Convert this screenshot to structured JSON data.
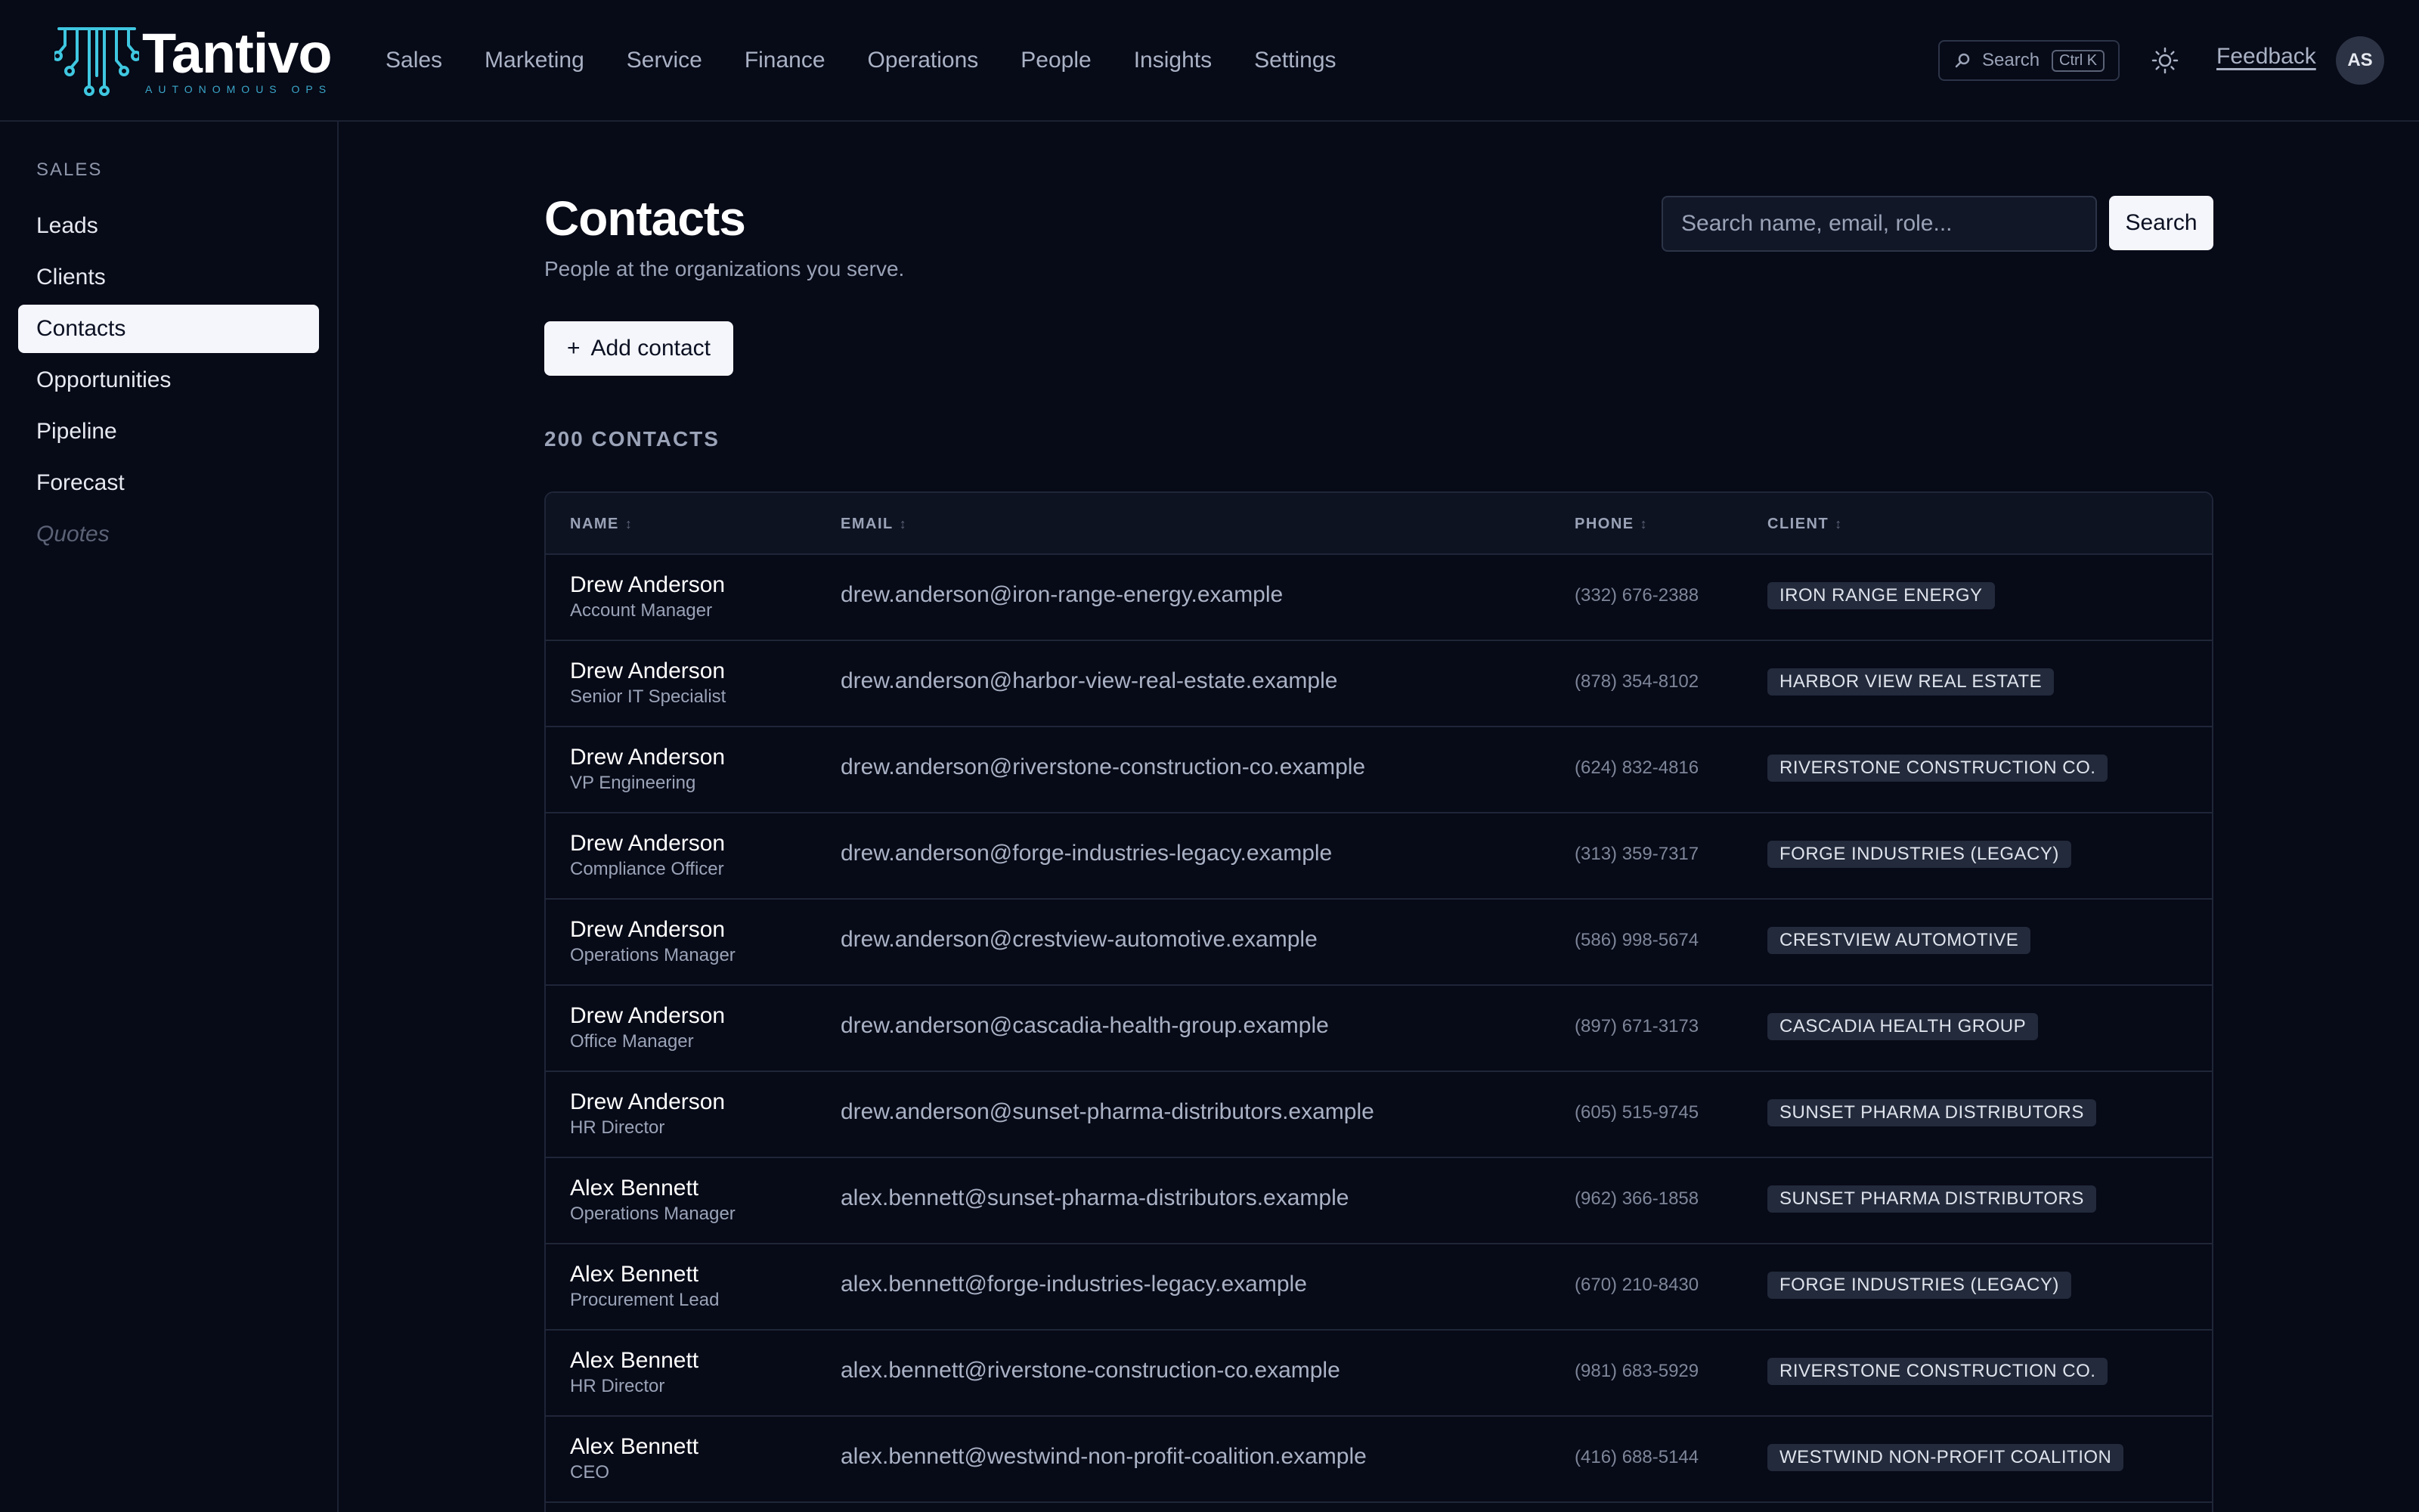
{
  "brand": {
    "name": "Tantivo",
    "tagline": "AUTONOMOUS OPS"
  },
  "nav": {
    "items": [
      {
        "label": "Sales",
        "active": true
      },
      {
        "label": "Marketing",
        "active": false
      },
      {
        "label": "Service",
        "active": false
      },
      {
        "label": "Finance",
        "active": false
      },
      {
        "label": "Operations",
        "active": false
      },
      {
        "label": "People",
        "active": false
      },
      {
        "label": "Insights",
        "active": false
      },
      {
        "label": "Settings",
        "active": false
      }
    ]
  },
  "topbar": {
    "search_label": "Search",
    "search_shortcut": "Ctrl K",
    "feedback_label": "Feedback",
    "avatar_initials": "AS"
  },
  "sidebar": {
    "heading": "SALES",
    "items": [
      {
        "label": "Leads",
        "state": "normal"
      },
      {
        "label": "Clients",
        "state": "normal"
      },
      {
        "label": "Contacts",
        "state": "active"
      },
      {
        "label": "Opportunities",
        "state": "normal"
      },
      {
        "label": "Pipeline",
        "state": "normal"
      },
      {
        "label": "Forecast",
        "state": "normal"
      },
      {
        "label": "Quotes",
        "state": "disabled"
      }
    ]
  },
  "page": {
    "title": "Contacts",
    "subtitle": "People at the organizations you serve.",
    "add_button_label": "Add contact",
    "add_button_icon": "+",
    "search_placeholder": "Search name, email, role...",
    "search_button_label": "Search",
    "count_label": "200 CONTACTS"
  },
  "table": {
    "columns": [
      "NAME",
      "EMAIL",
      "PHONE",
      "CLIENT"
    ],
    "sort_glyph": "↕",
    "rows": [
      {
        "name": "Drew Anderson",
        "role": "Account Manager",
        "email": "drew.anderson@iron-range-energy.example",
        "phone": "(332) 676-2388",
        "client": "IRON RANGE ENERGY"
      },
      {
        "name": "Drew Anderson",
        "role": "Senior IT Specialist",
        "email": "drew.anderson@harbor-view-real-estate.example",
        "phone": "(878) 354-8102",
        "client": "HARBOR VIEW REAL ESTATE"
      },
      {
        "name": "Drew Anderson",
        "role": "VP Engineering",
        "email": "drew.anderson@riverstone-construction-co.example",
        "phone": "(624) 832-4816",
        "client": "RIVERSTONE CONSTRUCTION CO."
      },
      {
        "name": "Drew Anderson",
        "role": "Compliance Officer",
        "email": "drew.anderson@forge-industries-legacy.example",
        "phone": "(313) 359-7317",
        "client": "FORGE INDUSTRIES (LEGACY)"
      },
      {
        "name": "Drew Anderson",
        "role": "Operations Manager",
        "email": "drew.anderson@crestview-automotive.example",
        "phone": "(586) 998-5674",
        "client": "CRESTVIEW AUTOMOTIVE"
      },
      {
        "name": "Drew Anderson",
        "role": "Office Manager",
        "email": "drew.anderson@cascadia-health-group.example",
        "phone": "(897) 671-3173",
        "client": "CASCADIA HEALTH GROUP"
      },
      {
        "name": "Drew Anderson",
        "role": "HR Director",
        "email": "drew.anderson@sunset-pharma-distributors.example",
        "phone": "(605) 515-9745",
        "client": "SUNSET PHARMA DISTRIBUTORS"
      },
      {
        "name": "Alex Bennett",
        "role": "Operations Manager",
        "email": "alex.bennett@sunset-pharma-distributors.example",
        "phone": "(962) 366-1858",
        "client": "SUNSET PHARMA DISTRIBUTORS"
      },
      {
        "name": "Alex Bennett",
        "role": "Procurement Lead",
        "email": "alex.bennett@forge-industries-legacy.example",
        "phone": "(670) 210-8430",
        "client": "FORGE INDUSTRIES (LEGACY)"
      },
      {
        "name": "Alex Bennett",
        "role": "HR Director",
        "email": "alex.bennett@riverstone-construction-co.example",
        "phone": "(981) 683-5929",
        "client": "RIVERSTONE CONSTRUCTION CO."
      },
      {
        "name": "Alex Bennett",
        "role": "CEO",
        "email": "alex.bennett@westwind-non-profit-coalition.example",
        "phone": "(416) 688-5144",
        "client": "WESTWIND NON-PROFIT COALITION"
      }
    ]
  },
  "icons": {
    "search": "search-icon",
    "theme": "sun-icon",
    "logo": "tantivo-logo-icon"
  },
  "colors": {
    "background": "#070a17",
    "accent_logo": "#3fc7e0",
    "active_nav_bg": "#f4f6fb"
  }
}
